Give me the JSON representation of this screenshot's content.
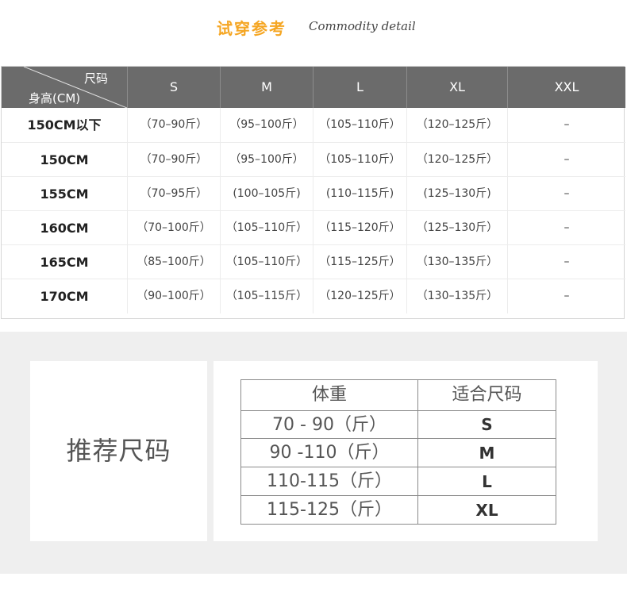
{
  "title": {
    "cn": "试穿参考",
    "en": "Commodity detail"
  },
  "size_chart": {
    "corner_top": "尺码",
    "corner_bottom": "身高(CM)",
    "sizes": [
      "S",
      "M",
      "L",
      "XL",
      "XXL"
    ],
    "rows": [
      {
        "height": "150CM以下",
        "cells": [
          "（70–90斤）",
          "（95–100斤）",
          "（105–110斤）",
          "（120–125斤）",
          "–"
        ]
      },
      {
        "height": "150CM",
        "cells": [
          "（70–90斤）",
          "（95–100斤）",
          "（105–110斤）",
          "（120–125斤）",
          "–"
        ]
      },
      {
        "height": "155CM",
        "cells": [
          "（70–95斤）",
          "(100–105斤)",
          "(110–115斤)",
          "(125–130斤)",
          "–"
        ]
      },
      {
        "height": "160CM",
        "cells": [
          "（70–100斤）",
          "（105–110斤）",
          "（115–120斤）",
          "（125–130斤）",
          "–"
        ]
      },
      {
        "height": "165CM",
        "cells": [
          "（85–100斤）",
          "（105–110斤）",
          "（115–125斤）",
          "（130–135斤）",
          "–"
        ]
      },
      {
        "height": "170CM",
        "cells": [
          "（90–100斤）",
          "（105–115斤）",
          "（120–125斤）",
          "（130–135斤）",
          "–"
        ]
      }
    ]
  },
  "recommendation": {
    "label": "推荐尺码",
    "headers": [
      "体重",
      "适合尺码"
    ],
    "rows": [
      {
        "weight": "70 - 90（斤）",
        "size": "S"
      },
      {
        "weight": "90 -110（斤）",
        "size": "M"
      },
      {
        "weight": "110-115（斤）",
        "size": "L"
      },
      {
        "weight": "115-125（斤）",
        "size": "XL"
      }
    ]
  }
}
